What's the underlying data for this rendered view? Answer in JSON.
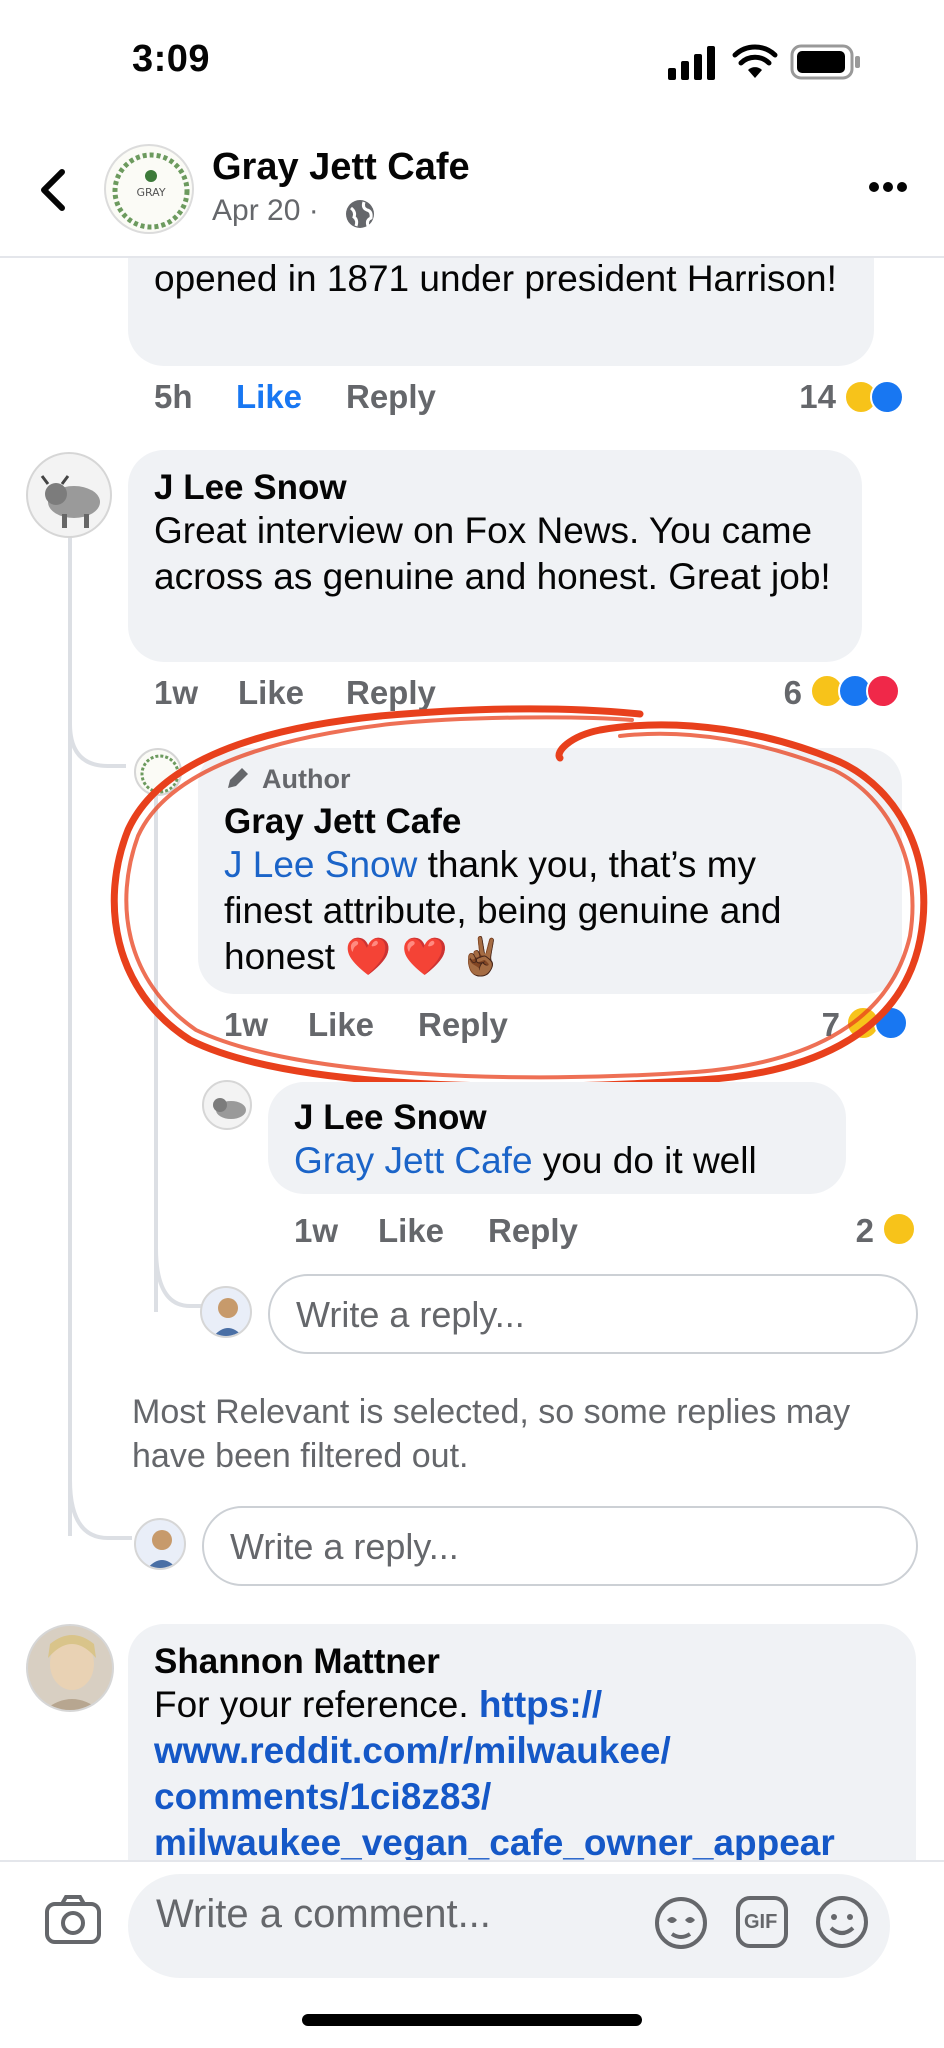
{
  "status_bar": {
    "time": "3:09"
  },
  "header": {
    "page_name": "Gray Jett Cafe",
    "post_date": "Apr 20 ·",
    "avatar_text": "GRAY"
  },
  "comments": [
    {
      "text": "opened in 1871 under president Harrison!",
      "time": "5h",
      "like_label": "Like",
      "reply_label": "Reply",
      "reaction_count": "14"
    },
    {
      "author": "J Lee Snow",
      "text": "Great interview on Fox News. You came across as genuine and honest. Great job!",
      "time": "1w",
      "like_label": "Like",
      "reply_label": "Reply",
      "reaction_count": "6"
    },
    {
      "badge": "Author",
      "author": "Gray Jett Cafe",
      "mention": "J Lee Snow",
      "text_line1": " thank you, that’s my",
      "text_line2": "finest attribute, being genuine and",
      "text_line3": "honest ❤️ ❤️ ✌🏾",
      "time": "1w",
      "like_label": "Like",
      "reply_label": "Reply",
      "reaction_count": "7"
    },
    {
      "author": "J Lee Snow",
      "mention": "Gray Jett Cafe",
      "text": " you do it well",
      "time": "1w",
      "like_label": "Like",
      "reply_label": "Reply",
      "reaction_count": "2"
    },
    {
      "author": "Shannon Mattner",
      "text": "For your reference. ",
      "link_line1": "https://",
      "link_line2": "www.reddit.com/r/milwaukee/",
      "link_line3": "comments/1ci8z83/",
      "link_line4": "milwaukee_vegan_cafe_owner_appear"
    }
  ],
  "reply_placeholder": "Write a reply...",
  "filter_notice": "Most Relevant is selected, so some replies may have been filtered out.",
  "comment_placeholder": "Write a comment...",
  "gif_label": "GIF",
  "colors": {
    "accent": "#1877f2",
    "mention": "#1b64c8",
    "annotation": "#e8401c",
    "bubble": "#f0f2f5"
  }
}
